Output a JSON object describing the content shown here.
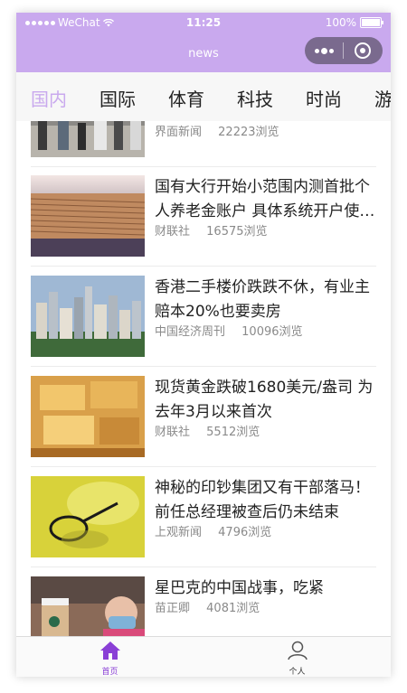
{
  "status": {
    "carrier": "WeChat",
    "time": "11:25",
    "battery": "100%"
  },
  "nav": {
    "title": "news"
  },
  "tabs": [
    "国内",
    "国际",
    "体育",
    "科技",
    "时尚",
    "游"
  ],
  "articles": [
    {
      "title": "",
      "source": "界面新闻",
      "views": "22223浏览"
    },
    {
      "title": "国有大行开始小范围内测首批个人养老金账户 具体系统开户使用将于后续公布",
      "source": "财联社",
      "views": "16575浏览"
    },
    {
      "title": "香港二手楼价跌跌不休，有业主赔本20%也要卖房",
      "source": "中国经济周刊",
      "views": "10096浏览"
    },
    {
      "title": "现货黄金跌破1680美元/盎司 为去年3月以来首次",
      "source": "财联社",
      "views": "5512浏览"
    },
    {
      "title": "神秘的印钞集团又有干部落马！前任总经理被查后仍未结束",
      "source": "上观新闻",
      "views": "4796浏览"
    },
    {
      "title": "星巴克的中国战事，吃紧",
      "source": "苗正卿",
      "views": "4081浏览"
    }
  ],
  "tabbar": {
    "home": "首页",
    "profile": "个人"
  },
  "colors": {
    "accent": "#c9a9ee",
    "active_tabbar": "#8a3fd6"
  }
}
